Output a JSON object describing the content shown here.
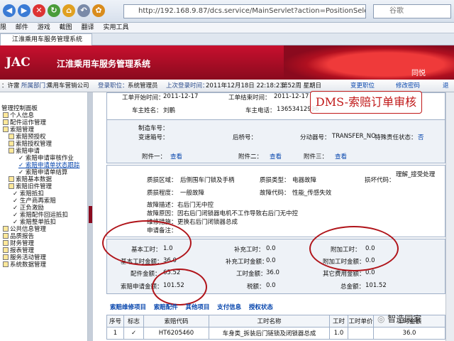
{
  "browser": {
    "url": "http://192.168.9.87/dcs.service/MainServlet?action=PositionSelect",
    "search_placeholder": "谷歌"
  },
  "menubar": [
    "限",
    "邮件",
    "游戏",
    "截图",
    "翻译",
    "实用工具"
  ],
  "tab": {
    "title": "江淮乘用车服务管理系统"
  },
  "banner": {
    "logo": "JAC",
    "system_title": "江淮乘用车服务管理系统",
    "car_text": "同悦"
  },
  "infobar": {
    "user_label": "：许雷",
    "dept_label": "所属部门：",
    "dept": "乘用车营销公司",
    "login_label": "登录职位：",
    "position": "系统管理员",
    "last_login_label": "上次登录时间：",
    "last_login": "2011年12月18日 22:18:23",
    "week": "第52周 星期日",
    "change_position": "变更职位",
    "change_password": "修改密码",
    "logout": "退"
  },
  "sidebar": {
    "items": [
      {
        "label": "管理控制面板"
      },
      {
        "label": "个人信息"
      },
      {
        "label": "配件运作管理"
      },
      {
        "label": "索赔管理"
      },
      {
        "label": "索赔预授权"
      },
      {
        "label": "索赔授权管理"
      },
      {
        "label": "索赔申请"
      },
      {
        "label": "索赔申请审核作业"
      },
      {
        "label": "索赔申请单状态跟踪"
      },
      {
        "label": "索赔申请单结算"
      },
      {
        "label": "索赔基本数据"
      },
      {
        "label": "索赔旧件管理"
      },
      {
        "label": "索赔抵扣"
      },
      {
        "label": "生产商再索赔"
      },
      {
        "label": "正负激励"
      },
      {
        "label": "索赔配件回运抵扣"
      },
      {
        "label": "索赔整单抵扣"
      },
      {
        "label": "公共信息管理"
      },
      {
        "label": "品质报告"
      },
      {
        "label": "财务管理"
      },
      {
        "label": "报表管理"
      },
      {
        "label": "服务活动管理"
      },
      {
        "label": "系统数据管理"
      }
    ]
  },
  "form": {
    "work_start_label": "工单开始时间：",
    "work_start": "2011-12-17",
    "work_end_label": "工单结束时间：",
    "work_end": "2011-12-17",
    "owner_label": "车主姓名：",
    "owner": "刘鹏",
    "owner_phone_label": "车主电话：",
    "owner_phone": "13653412996",
    "mfg_no_label": "制造车号：",
    "trans_no_label": "变速箱号：",
    "rear_axle_label": "后桥号：",
    "dist_no_label": "分动器号：",
    "dist_no": "TRANSFER_NO",
    "special_label": "特殊责任状态：",
    "special": "否",
    "att1_label": "附件一：",
    "att2_label": "附件二：",
    "att3_label": "附件三：",
    "view": "查看",
    "area_label": "质损区域：",
    "area": "后侧围车门锁及手柄",
    "type_label": "质损类型：",
    "type": "电器故障",
    "code_label": "损坏代码：",
    "code": "理解_接受处理",
    "degree_label": "质损程度：",
    "degree": "一般故障",
    "fault_label": "故障代码：",
    "fault": "性能_传感失效",
    "desc_label": "故障描述：",
    "desc": "右后门无中控",
    "cause_label": "故障原因：",
    "cause": "因右后门闭锁器电机不工作导致右后门无中控",
    "measure_label": "维修措施：",
    "measure": "更换右后门闭锁器总成",
    "remark_label": "申请备注："
  },
  "totals": {
    "base_hours_label": "基本工时：",
    "base_hours": "1.0",
    "extra_hours_label": "补充工时：",
    "extra_hours": "0.0",
    "add_hours_label": "附加工时：",
    "add_hours": "0.0",
    "base_amt_label": "基本工时金额：",
    "base_amt": "36.0",
    "extra_amt_label": "补充工时金额：",
    "extra_amt": "0.0",
    "add_amt_label": "附加工时金额：",
    "add_amt": "0.0",
    "parts_amt_label": "配件金额：",
    "parts_amt": "65.52",
    "labor_amt_label": "工时金额：",
    "labor_amt": "36.0",
    "other_amt_label": "其它费用金额：",
    "other_amt": "0.0",
    "claim_amt_label": "索赔申请金额：",
    "claim_amt": "101.52",
    "tax_label": "税额：",
    "tax": "0.0",
    "total_label": "总金额：",
    "total": "101.52"
  },
  "overlay": {
    "dms_title": "DMS-索赔订单审核"
  },
  "subtabs": [
    "索赔维修项目",
    "索赔配件",
    "其他项目",
    "支付信息",
    "授权状态"
  ],
  "table": {
    "headers": [
      "序号",
      "标志",
      "索赔代码",
      "工时名称",
      "工时",
      "工时单价",
      "工时金额"
    ],
    "rows": [
      [
        "1",
        "✓",
        "HT6205460",
        "车身类_拆装后门链锁及闭锁器总成",
        "1.0",
        "",
        "36.0"
      ]
    ]
  },
  "watermark": "智造园家"
}
